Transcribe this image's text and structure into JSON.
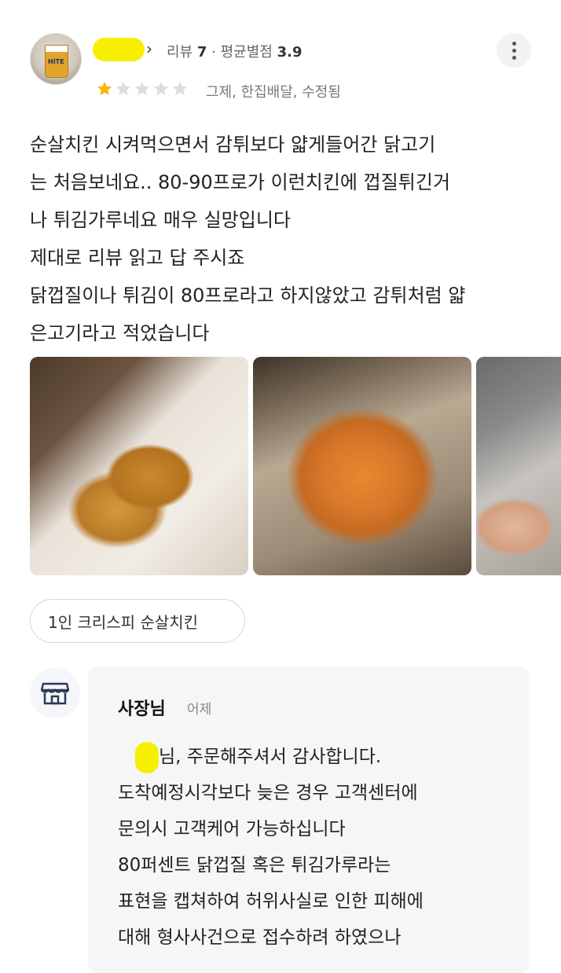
{
  "header": {
    "meta_reviews_label": "리뷰",
    "meta_reviews_count": "7",
    "meta_separator": "·",
    "meta_avg_label": "평균별점",
    "meta_avg_value": "3.9",
    "order_meta": "그제, 한집배달, 수정됨",
    "rating": {
      "value": 1,
      "max": 5
    },
    "colors": {
      "star_on": "#f5b800",
      "star_off": "#dddddd",
      "redaction": "#f6f000"
    }
  },
  "review": {
    "lines": [
      "순살치킨 시켜먹으면서 감튀보다 얇게들어간 닭고기",
      "는 처음보네요.. 80-90프로가 이런치킨에 껍질튀긴거",
      "나 튀김가루네요 매우 실망입니다",
      "제대로 리뷰 읽고 답 주시죠",
      "닭껍질이나 튀김이 80프로라고 하지않았고 감튀처럼 얇",
      "은고기라고 적었습니다"
    ]
  },
  "menu_chip": "1인 크리스피 순살치킨",
  "owner_reply": {
    "name": "사장님",
    "time": "어제",
    "lines": [
      "님, 주문해주셔서 감사합니다.",
      "도착예정시각보다 늦은 경우 고객센터에",
      "문의시 고객케어 가능하십니다",
      "80퍼센트 닭껍질 혹은 튀김가루라는",
      "표현을 캡쳐하여 허위사실로 인한 피해에",
      "대해 형사사건으로 접수하려 하였으나"
    ]
  },
  "icons": {
    "more": "more-vertical-icon",
    "store": "store-icon",
    "chevron": "chevron-right-icon"
  }
}
